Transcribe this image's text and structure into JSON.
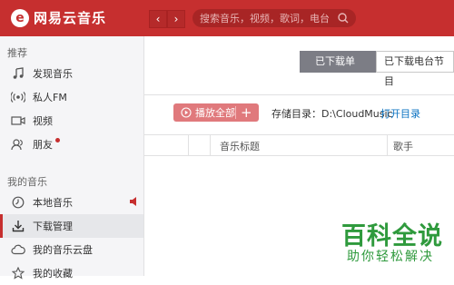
{
  "app": {
    "logo_char": "e",
    "title": "网易云音乐"
  },
  "nav": {
    "back": "‹",
    "forward": "›"
  },
  "search": {
    "placeholder": "搜索音乐，视频，歌词，电台"
  },
  "sidebar": {
    "section1_title": "推荐",
    "recommend": [
      {
        "label": "发现音乐",
        "icon": "music-note-icon"
      },
      {
        "label": "私人FM",
        "icon": "radio-icon"
      },
      {
        "label": "视频",
        "icon": "video-icon"
      },
      {
        "label": "朋友",
        "icon": "friends-icon"
      }
    ],
    "section2_title": "我的音乐",
    "my_music": [
      {
        "label": "本地音乐",
        "icon": "clock-music-icon"
      },
      {
        "label": "下载管理",
        "icon": "download-icon"
      },
      {
        "label": "我的音乐云盘",
        "icon": "cloud-icon"
      },
      {
        "label": "我的收藏",
        "icon": "star-icon"
      }
    ]
  },
  "main": {
    "tabs": [
      "已下载单曲",
      "已下载电台节目"
    ],
    "play_all": "播放全部",
    "plus": "+",
    "storage_label": "存储目录：D:\\CloudMusic",
    "open_dir": "打开目录",
    "columns": [
      "音乐标题",
      "歌手"
    ]
  },
  "watermark": {
    "line1": "百科全说",
    "line2": "助你轻松解决"
  },
  "colors": {
    "brand_red": "#c62f2f",
    "link_blue": "#0c73c2",
    "watermark_green": "#2f9a3d"
  }
}
